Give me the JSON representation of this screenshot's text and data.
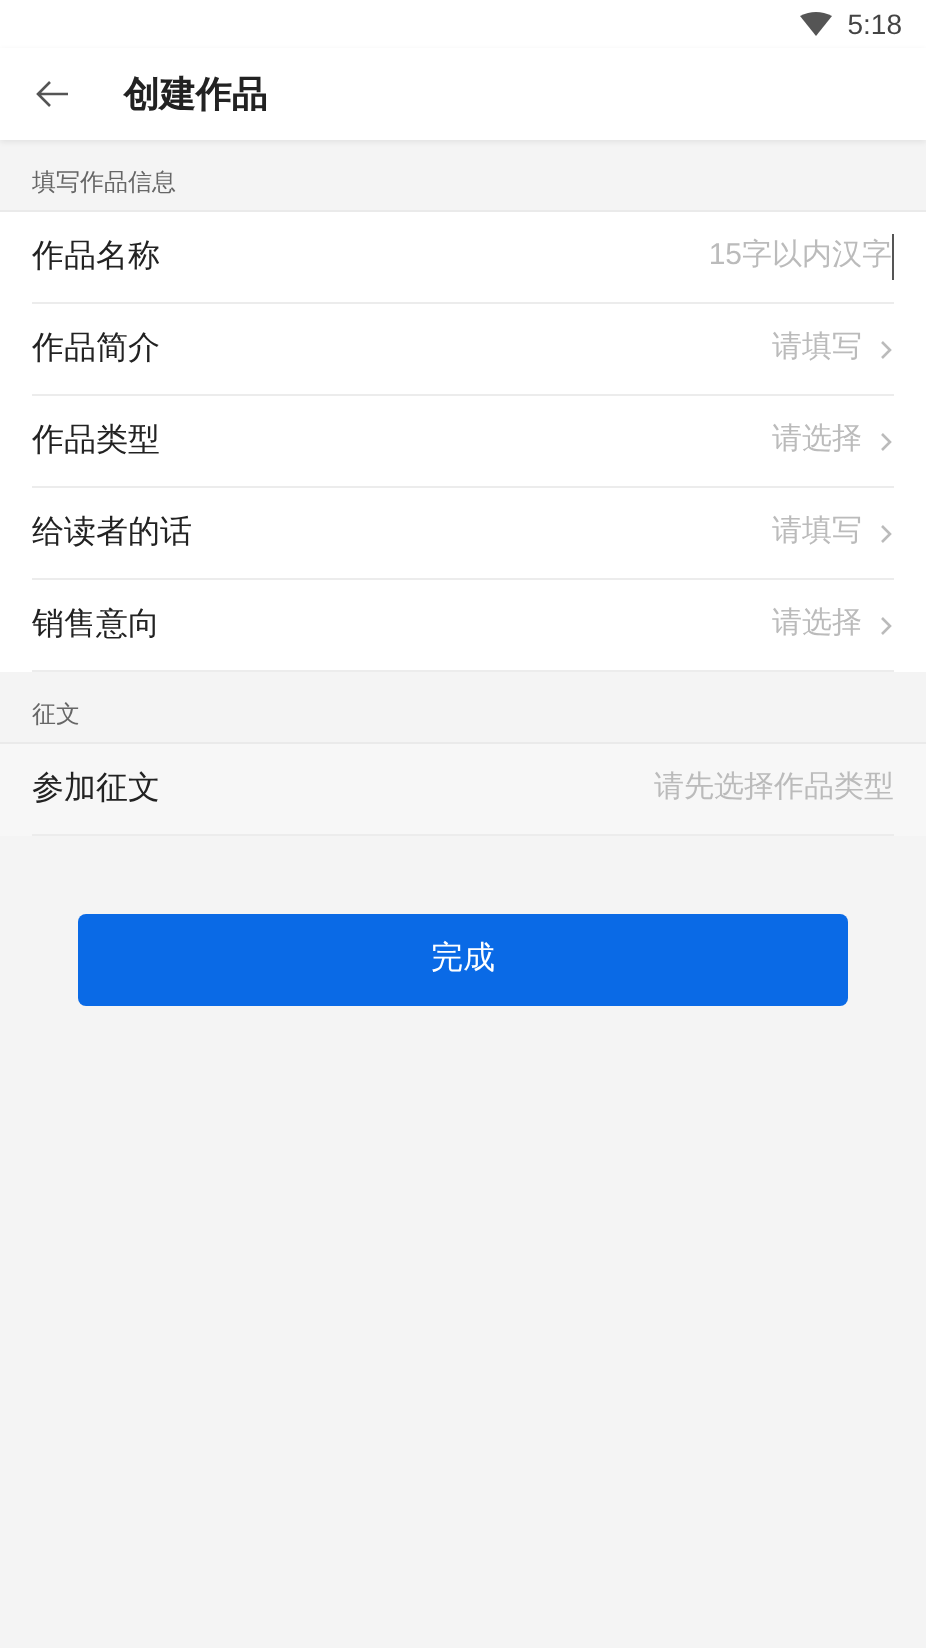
{
  "status_bar": {
    "time": "5:18"
  },
  "header": {
    "title": "创建作品"
  },
  "sections": [
    {
      "title": "填写作品信息",
      "rows": [
        {
          "label": "作品名称",
          "kind": "input",
          "placeholder": "15字以内汉字",
          "disabled": false
        },
        {
          "label": "作品简介",
          "kind": "select",
          "value": "请填写",
          "disabled": false
        },
        {
          "label": "作品类型",
          "kind": "select",
          "value": "请选择",
          "disabled": false
        },
        {
          "label": "给读者的话",
          "kind": "select",
          "value": "请填写",
          "disabled": false
        },
        {
          "label": "销售意向",
          "kind": "select",
          "value": "请选择",
          "disabled": false
        }
      ]
    },
    {
      "title": "征文",
      "rows": [
        {
          "label": "参加征文",
          "kind": "select",
          "value": "请先选择作品类型",
          "disabled": true
        }
      ]
    }
  ],
  "submit_button": "完成"
}
